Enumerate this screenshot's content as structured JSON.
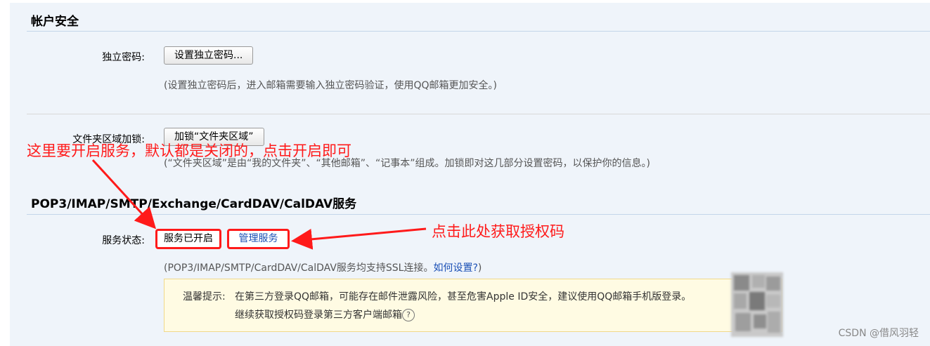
{
  "account_security": {
    "title": "帐户安全",
    "independent_password": {
      "label": "独立密码:",
      "button": "设置独立密码...",
      "hint": "(设置独立密码后，进入邮箱需要输入独立密码验证，使用QQ邮箱更加安全。)"
    },
    "folder_lock": {
      "label": "文件夹区域加锁:",
      "button": "加锁“文件夹区域”",
      "hint": "(“文件夹区域”是由“我的文件夹”、“其他邮箱”、“记事本”组成。加锁即对这几部分设置密码，以保护你的信息。)"
    }
  },
  "services": {
    "title": "POP3/IMAP/SMTP/Exchange/CardDAV/CalDAV服务",
    "status_label": "服务状态:",
    "status_value": "服务已开启",
    "manage_link": "管理服务",
    "ssl_hint": "(POP3/IMAP/SMTP/CardDAV/CalDAV服务均支持SSL连接。",
    "how_to_link": "如何设置?",
    "ssl_hint_close": ")",
    "warning": {
      "prefix": "温馨提示:",
      "line1": "在第三方登录QQ邮箱，可能存在邮件泄露风险，甚至危害Apple ID安全，建议使用QQ邮箱手机版登录。",
      "line2": "继续获取授权码登录第三方客户端邮箱",
      "help_icon_glyph": "?"
    }
  },
  "annotations": {
    "open_service": "这里要开启服务，默认都是关闭的，点击开启即可",
    "get_auth_code": "点击此处获取授权码",
    "color": "#ff1a1a"
  },
  "watermark": "CSDN @借风羽轻"
}
